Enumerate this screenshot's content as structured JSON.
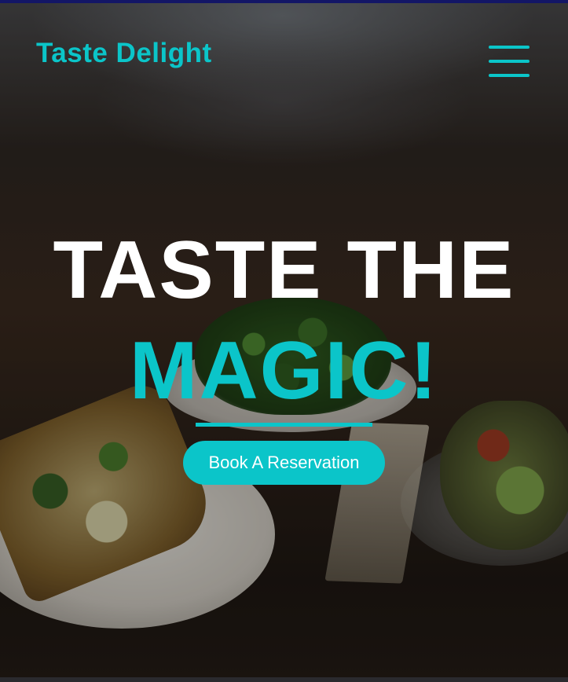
{
  "header": {
    "logo_text": "Taste Delight",
    "menu_icon": "hamburger-menu-icon"
  },
  "hero": {
    "headline_line1": "TASTE THE",
    "headline_line2": "MAGIC!",
    "cta_label": "Book A Reservation"
  },
  "colors": {
    "accent": "#0bc5c9",
    "headline_primary": "#ffffff",
    "top_strip": "#1b1f8e"
  }
}
